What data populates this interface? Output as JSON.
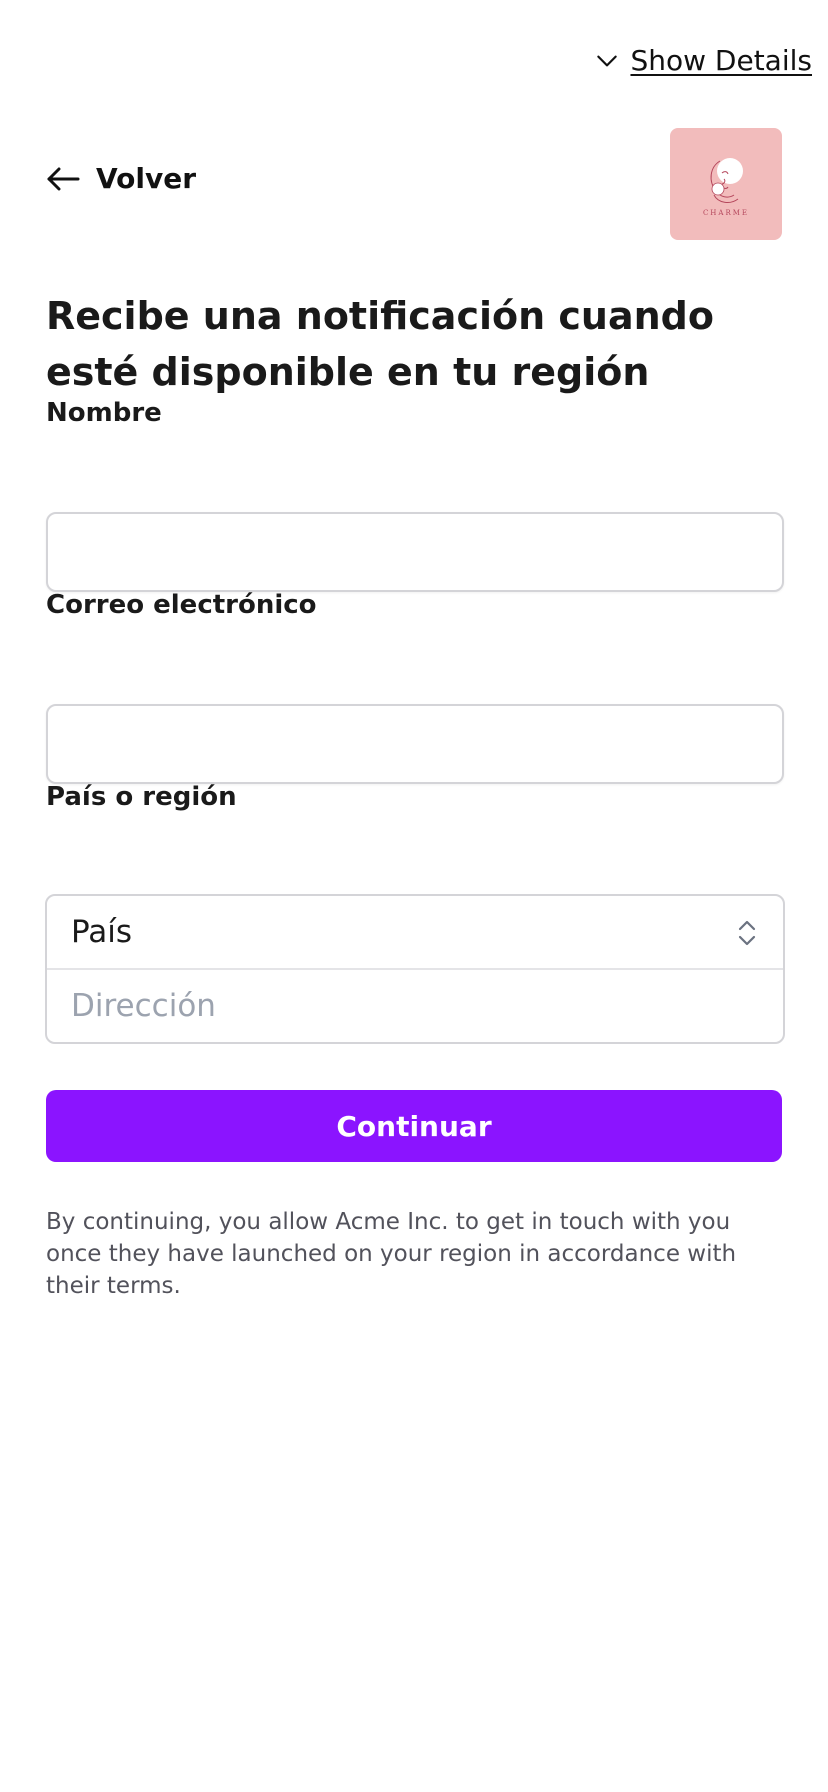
{
  "header": {
    "show_details_label": "Show Details",
    "show_details_icon": "chevron-down-icon"
  },
  "nav": {
    "back_label": "Volver",
    "back_icon": "arrow-left-icon"
  },
  "brand": {
    "logo_text": "CHARME",
    "logo_background": "#f2bcbc"
  },
  "form": {
    "heading": "Recibe una notificación cuando esté disponible en tu región",
    "name_label": "Nombre",
    "name_value": "",
    "email_label": "Correo electrónico",
    "email_value": "",
    "region_label": "País o región",
    "country_value": "País",
    "address_placeholder": "Dirección",
    "submit_label": "Continuar",
    "submit_color": "#8b14ff"
  },
  "footer": {
    "disclaimer": "By continuing, you allow Acme Inc. to get in touch with you once they have launched on your region in accordance with their terms."
  }
}
